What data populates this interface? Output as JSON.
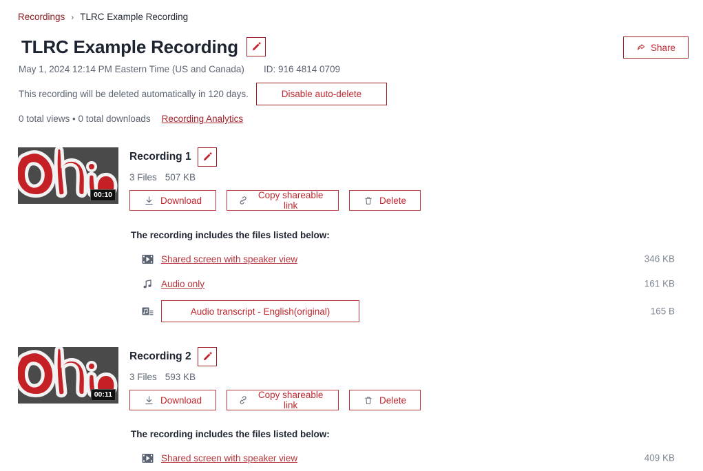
{
  "breadcrumb": {
    "parent": "Recordings",
    "separator": "›",
    "current": "TLRC Example Recording"
  },
  "header": {
    "title": "TLRC Example Recording",
    "edit_icon": "pencil-icon",
    "share_label": "Share",
    "share_icon": "share-arrow-icon",
    "date": "May 1, 2024 12:14 PM Eastern Time (US and Canada)",
    "id": "ID: 916 4814 0709",
    "autodelete_text": "This recording will be deleted automatically in 120 days.",
    "autodelete_button": "Disable auto-delete",
    "stats": "0 total views • 0 total downloads",
    "analytics_link": "Recording Analytics"
  },
  "colors": {
    "accent_red": "#c0262e",
    "link_red": "#b5323a",
    "border_red": "#9b1c23",
    "title_dark": "#1d2430",
    "muted_gray": "#5b6472",
    "thumb_bg": "#4a4a4a"
  },
  "actions": {
    "download_label": "Download",
    "download_icon": "download-icon",
    "copy_label": "Copy shareable link",
    "copy_icon": "link-icon",
    "delete_label": "Delete",
    "delete_icon": "trash-icon"
  },
  "files_caption": "The recording includes the files listed below:",
  "recordings": [
    {
      "title": "Recording 1",
      "file_count": "3 Files",
      "total_size": "507 KB",
      "duration": "00:10",
      "thumbnail_alt": "ohio-logo-thumbnail",
      "files": [
        {
          "name": "Shared screen with speaker view",
          "size": "346 KB",
          "icon": "video-file-icon",
          "kind": "link"
        },
        {
          "name": "Audio only",
          "size": "161 KB",
          "icon": "audio-file-icon",
          "kind": "link"
        },
        {
          "name": "Audio transcript - English(original)",
          "size": "165 B",
          "icon": "transcript-file-icon",
          "kind": "button"
        }
      ]
    },
    {
      "title": "Recording 2",
      "file_count": "3 Files",
      "total_size": "593 KB",
      "duration": "00:11",
      "thumbnail_alt": "ohio-logo-thumbnail",
      "files": [
        {
          "name": "Shared screen with speaker view",
          "size": "409 KB",
          "icon": "video-file-icon",
          "kind": "link"
        }
      ]
    }
  ]
}
